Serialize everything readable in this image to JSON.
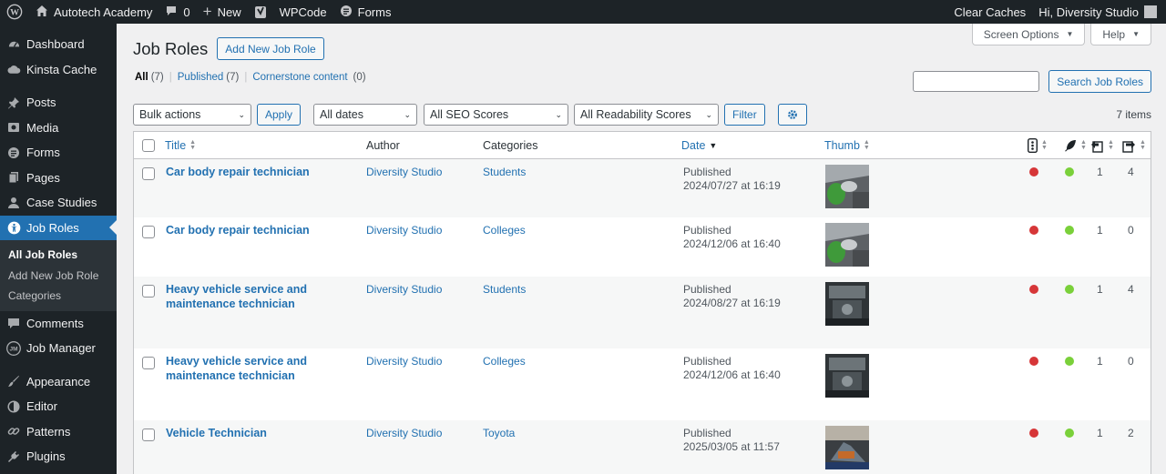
{
  "admin_bar": {
    "site_name": "Autotech Academy",
    "comments_count": "0",
    "new_label": "New",
    "wpcode_label": "WPCode",
    "forms_label": "Forms",
    "clear_caches": "Clear Caches",
    "greeting": "Hi, Diversity Studio"
  },
  "sidebar": {
    "items": [
      {
        "label": "Dashboard",
        "icon": "dashboard-icon"
      },
      {
        "label": "Kinsta Cache",
        "icon": "cloud-icon"
      },
      {
        "label": "Posts",
        "icon": "pin-icon"
      },
      {
        "label": "Media",
        "icon": "media-icon"
      },
      {
        "label": "Forms",
        "icon": "forms-icon"
      },
      {
        "label": "Pages",
        "icon": "pages-icon"
      },
      {
        "label": "Case Studies",
        "icon": "person-icon"
      },
      {
        "label": "Job Roles",
        "icon": "universal-access-icon"
      },
      {
        "label": "Comments",
        "icon": "comment-icon"
      },
      {
        "label": "Job Manager",
        "icon": "jm-icon"
      },
      {
        "label": "Appearance",
        "icon": "brush-icon"
      },
      {
        "label": "Editor",
        "icon": "editor-icon"
      },
      {
        "label": "Patterns",
        "icon": "link-icon"
      },
      {
        "label": "Plugins",
        "icon": "plugin-icon"
      }
    ],
    "submenu": [
      "All Job Roles",
      "Add New Job Role",
      "Categories"
    ]
  },
  "screen_meta": {
    "screen_options": "Screen Options",
    "help": "Help"
  },
  "page": {
    "title": "Job Roles",
    "add_new": "Add New Job Role"
  },
  "views": {
    "all": "All",
    "all_count": "(7)",
    "published": "Published",
    "published_count": "(7)",
    "cornerstone": "Cornerstone content",
    "cornerstone_count": "(0)"
  },
  "search": {
    "button": "Search Job Roles",
    "value": ""
  },
  "tablenav": {
    "bulk_actions": "Bulk actions",
    "apply": "Apply",
    "dates": "All dates",
    "seo": "All SEO Scores",
    "readability": "All Readability Scores",
    "filter": "Filter",
    "items": "7 items"
  },
  "columns": {
    "title": "Title",
    "author": "Author",
    "categories": "Categories",
    "date": "Date",
    "thumb": "Thumb"
  },
  "colors": {
    "seo_bad": "#d63638",
    "readability_good": "#7ad03a",
    "accent": "#2271b1"
  },
  "rows": [
    {
      "title": "Car body repair technician",
      "author": "Diversity Studio",
      "category": "Students",
      "status": "Published",
      "date": "2024/07/27 at 16:19",
      "links_out": "1",
      "links_in": "4"
    },
    {
      "title": "Car body repair technician",
      "author": "Diversity Studio",
      "category": "Colleges",
      "status": "Published",
      "date": "2024/12/06 at 16:40",
      "links_out": "1",
      "links_in": "0"
    },
    {
      "title": "Heavy vehicle service and maintenance technician",
      "author": "Diversity Studio",
      "category": "Students",
      "status": "Published",
      "date": "2024/08/27 at 16:19",
      "links_out": "1",
      "links_in": "4"
    },
    {
      "title": "Heavy vehicle service and maintenance technician",
      "author": "Diversity Studio",
      "category": "Colleges",
      "status": "Published",
      "date": "2024/12/06 at 16:40",
      "links_out": "1",
      "links_in": "0"
    },
    {
      "title": "Vehicle Technician",
      "author": "Diversity Studio",
      "category": "Toyota",
      "status": "Published",
      "date": "2025/03/05 at 11:57",
      "links_out": "1",
      "links_in": "2"
    }
  ]
}
